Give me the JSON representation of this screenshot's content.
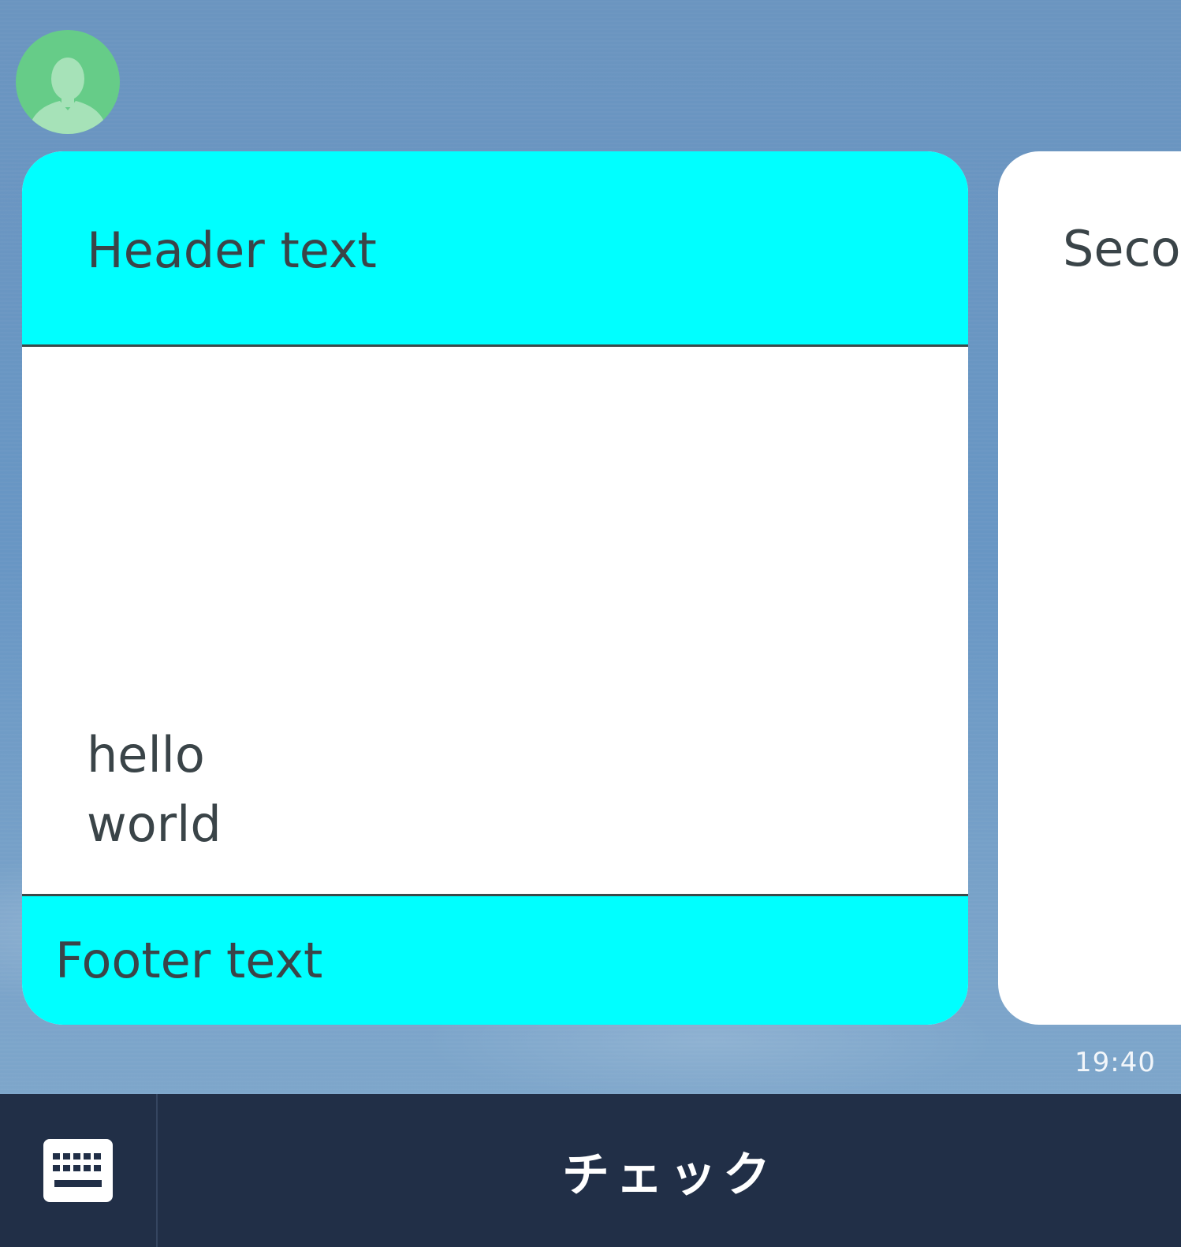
{
  "chat": {
    "bubble_1": {
      "header": "Header text",
      "body_line_1": "hello",
      "body_line_2": "world",
      "footer": "Footer text"
    },
    "bubble_2": {
      "header": "Secon"
    },
    "timestamp": "19:40"
  },
  "bottom_bar": {
    "keyboard_icon": "keyboard-icon",
    "rich_menu_label": "チェック"
  },
  "colors": {
    "bubble_accent": "#00ffff",
    "bottom_bar": "#212f47",
    "avatar": "#66cc88"
  }
}
